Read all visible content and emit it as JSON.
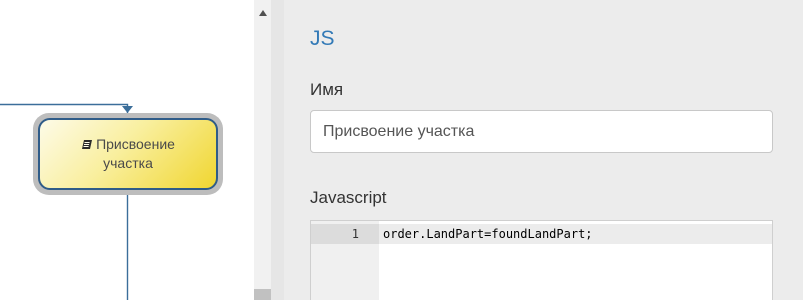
{
  "diagram": {
    "task": {
      "label_line1": "Присвоение",
      "label_line2": "участка",
      "icon": "book-icon"
    }
  },
  "panel": {
    "title": "JS",
    "name_label": "Имя",
    "name_value": "Присвоение участка",
    "script_label": "Javascript",
    "editor": {
      "line_number": "1",
      "code": "order.LandPart=foundLandPart;"
    }
  },
  "colors": {
    "accent": "#337ab7",
    "node_border": "#2f5c88",
    "node_fill_end": "#f0d630",
    "connector": "#3b6e9a"
  }
}
